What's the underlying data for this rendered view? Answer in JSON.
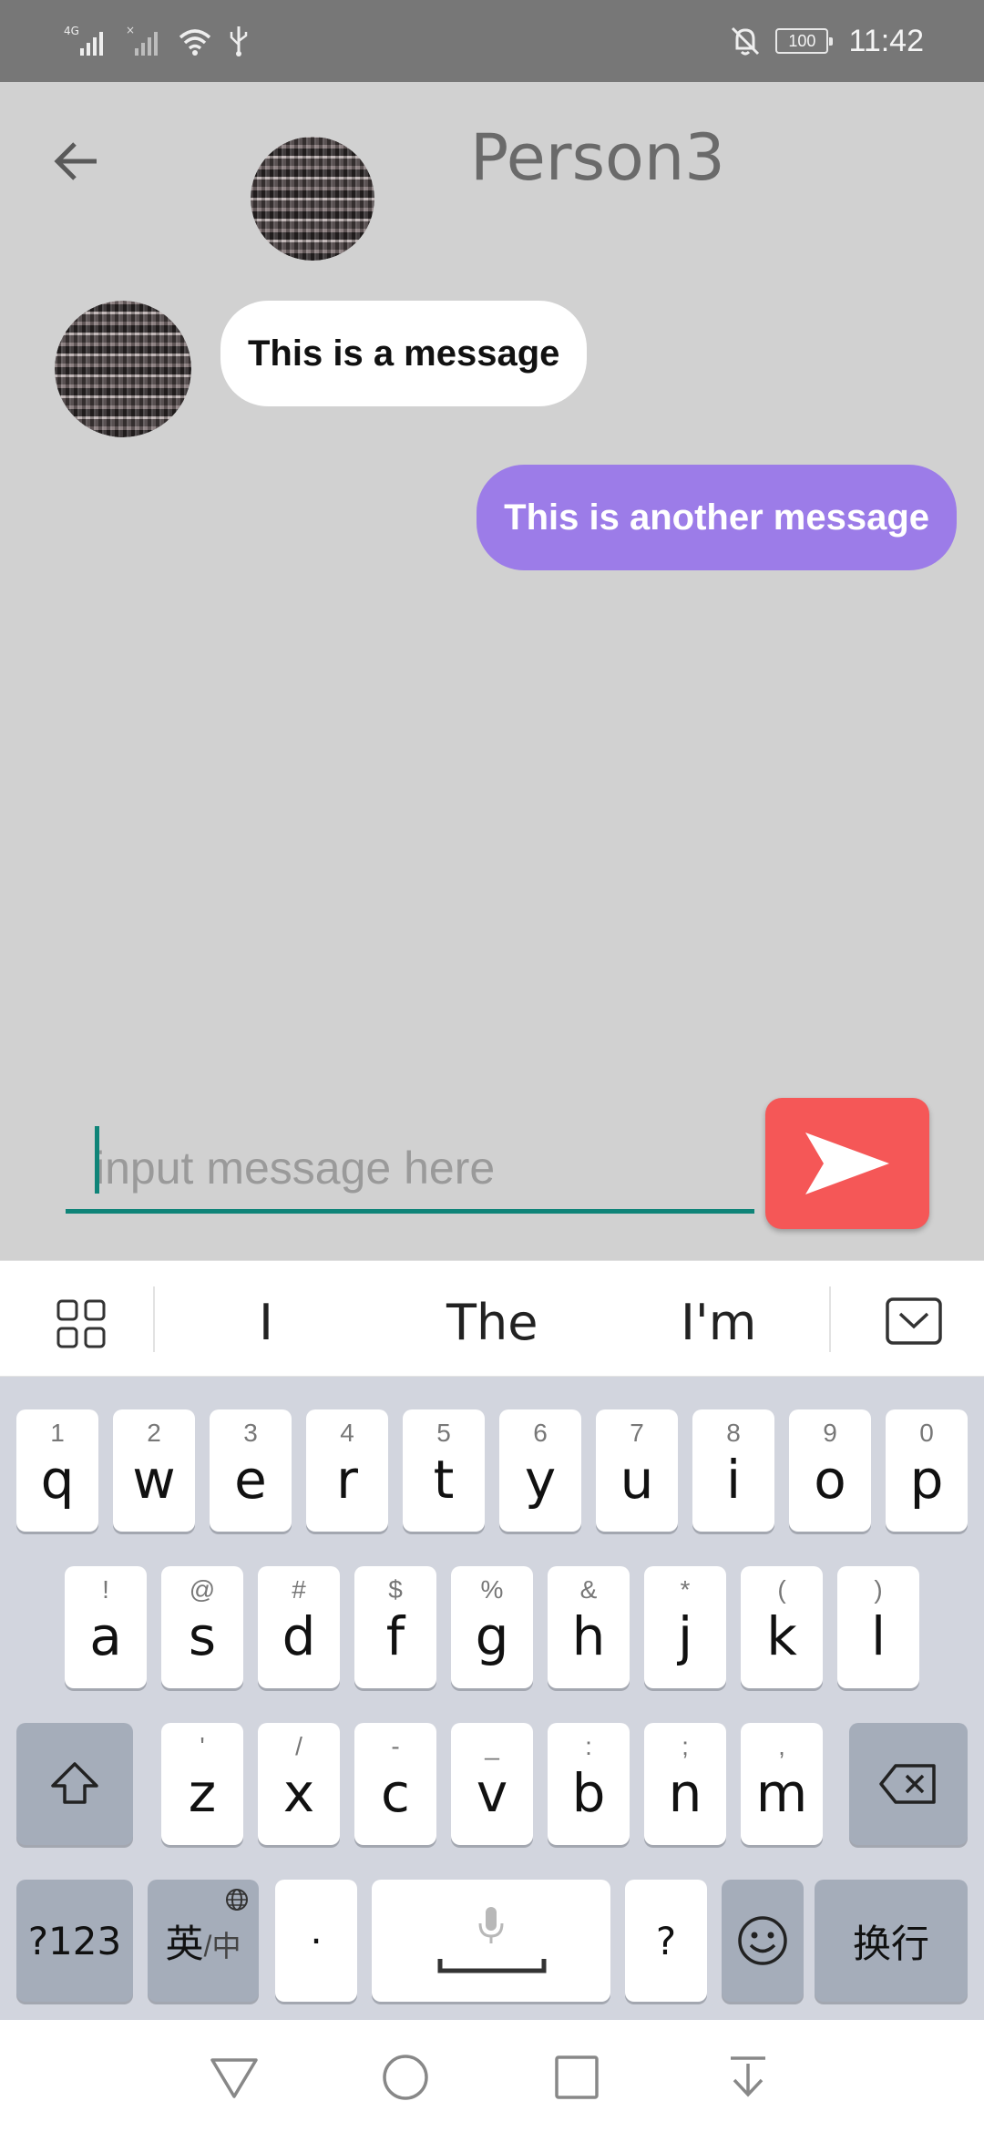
{
  "status_bar": {
    "network": "4G",
    "time": "11:42",
    "battery": "100"
  },
  "header": {
    "title": "Person3"
  },
  "messages": [
    {
      "direction": "incoming",
      "text": "This is a message"
    },
    {
      "direction": "outgoing",
      "text": "This is another message"
    }
  ],
  "composer": {
    "placeholder": "input message here"
  },
  "keyboard": {
    "suggestions": [
      "I",
      "The",
      "I'm"
    ],
    "row1": [
      {
        "main": "q",
        "sub": "1"
      },
      {
        "main": "w",
        "sub": "2"
      },
      {
        "main": "e",
        "sub": "3"
      },
      {
        "main": "r",
        "sub": "4"
      },
      {
        "main": "t",
        "sub": "5"
      },
      {
        "main": "y",
        "sub": "6"
      },
      {
        "main": "u",
        "sub": "7"
      },
      {
        "main": "i",
        "sub": "8"
      },
      {
        "main": "o",
        "sub": "9"
      },
      {
        "main": "p",
        "sub": "0"
      }
    ],
    "row2": [
      {
        "main": "a",
        "sub": "!"
      },
      {
        "main": "s",
        "sub": "@"
      },
      {
        "main": "d",
        "sub": "#"
      },
      {
        "main": "f",
        "sub": "$"
      },
      {
        "main": "g",
        "sub": "%"
      },
      {
        "main": "h",
        "sub": "&"
      },
      {
        "main": "j",
        "sub": "*"
      },
      {
        "main": "k",
        "sub": "("
      },
      {
        "main": "l",
        "sub": ")"
      }
    ],
    "row3": [
      {
        "main": "z",
        "sub": "'"
      },
      {
        "main": "x",
        "sub": "/"
      },
      {
        "main": "c",
        "sub": "-"
      },
      {
        "main": "v",
        "sub": "_"
      },
      {
        "main": "b",
        "sub": ":"
      },
      {
        "main": "n",
        "sub": ";"
      },
      {
        "main": "m",
        "sub": ","
      }
    ],
    "symbols_label": "?123",
    "lang_label_main": "英",
    "lang_label_sub": "/中",
    "dot_label": "·",
    "question_label": "?",
    "enter_label": "换行"
  },
  "colors": {
    "accent": "#0f8478",
    "send": "#f55757",
    "outgoing_bubble": "#9c7ce8"
  }
}
